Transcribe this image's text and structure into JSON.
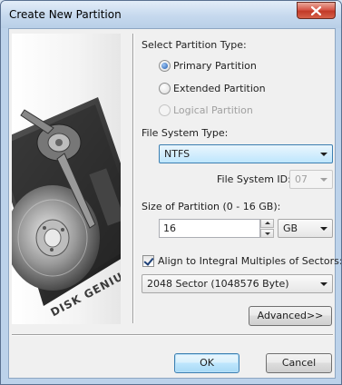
{
  "window": {
    "title": "Create New Partition"
  },
  "banner": {
    "brand_text": "DISK GENIUS"
  },
  "partition_type": {
    "label": "Select Partition Type:",
    "options": [
      {
        "label": "Primary Partition",
        "checked": true,
        "enabled": true
      },
      {
        "label": "Extended Partition",
        "checked": false,
        "enabled": true
      },
      {
        "label": "Logical Partition",
        "checked": false,
        "enabled": false
      }
    ]
  },
  "file_system": {
    "label": "File System Type:",
    "selected": "NTFS",
    "id_label": "File System ID:",
    "id_value": "07"
  },
  "size": {
    "label": "Size of Partition (0 - 16 GB):",
    "value": "16",
    "unit": "GB"
  },
  "align": {
    "checked": true,
    "label": "Align to Integral Multiples of Sectors:",
    "selected": "2048 Sector (1048576 Byte)"
  },
  "buttons": {
    "advanced": "Advanced>>",
    "ok": "OK",
    "cancel": "Cancel"
  },
  "colors": {
    "title_bar": "#c6d9ee",
    "close_button": "#c23a28",
    "focus_accent": "#3c7fb1",
    "dialog_body": "#f0f0f0"
  }
}
